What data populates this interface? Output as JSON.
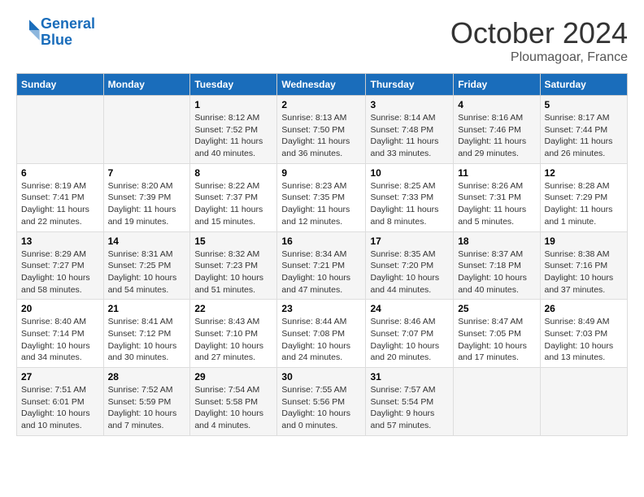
{
  "header": {
    "logo_line1": "General",
    "logo_line2": "Blue",
    "month": "October 2024",
    "location": "Ploumagoar, France"
  },
  "weekdays": [
    "Sunday",
    "Monday",
    "Tuesday",
    "Wednesday",
    "Thursday",
    "Friday",
    "Saturday"
  ],
  "weeks": [
    [
      {
        "num": "",
        "info": ""
      },
      {
        "num": "",
        "info": ""
      },
      {
        "num": "1",
        "info": "Sunrise: 8:12 AM\nSunset: 7:52 PM\nDaylight: 11 hours and 40 minutes."
      },
      {
        "num": "2",
        "info": "Sunrise: 8:13 AM\nSunset: 7:50 PM\nDaylight: 11 hours and 36 minutes."
      },
      {
        "num": "3",
        "info": "Sunrise: 8:14 AM\nSunset: 7:48 PM\nDaylight: 11 hours and 33 minutes."
      },
      {
        "num": "4",
        "info": "Sunrise: 8:16 AM\nSunset: 7:46 PM\nDaylight: 11 hours and 29 minutes."
      },
      {
        "num": "5",
        "info": "Sunrise: 8:17 AM\nSunset: 7:44 PM\nDaylight: 11 hours and 26 minutes."
      }
    ],
    [
      {
        "num": "6",
        "info": "Sunrise: 8:19 AM\nSunset: 7:41 PM\nDaylight: 11 hours and 22 minutes."
      },
      {
        "num": "7",
        "info": "Sunrise: 8:20 AM\nSunset: 7:39 PM\nDaylight: 11 hours and 19 minutes."
      },
      {
        "num": "8",
        "info": "Sunrise: 8:22 AM\nSunset: 7:37 PM\nDaylight: 11 hours and 15 minutes."
      },
      {
        "num": "9",
        "info": "Sunrise: 8:23 AM\nSunset: 7:35 PM\nDaylight: 11 hours and 12 minutes."
      },
      {
        "num": "10",
        "info": "Sunrise: 8:25 AM\nSunset: 7:33 PM\nDaylight: 11 hours and 8 minutes."
      },
      {
        "num": "11",
        "info": "Sunrise: 8:26 AM\nSunset: 7:31 PM\nDaylight: 11 hours and 5 minutes."
      },
      {
        "num": "12",
        "info": "Sunrise: 8:28 AM\nSunset: 7:29 PM\nDaylight: 11 hours and 1 minute."
      }
    ],
    [
      {
        "num": "13",
        "info": "Sunrise: 8:29 AM\nSunset: 7:27 PM\nDaylight: 10 hours and 58 minutes."
      },
      {
        "num": "14",
        "info": "Sunrise: 8:31 AM\nSunset: 7:25 PM\nDaylight: 10 hours and 54 minutes."
      },
      {
        "num": "15",
        "info": "Sunrise: 8:32 AM\nSunset: 7:23 PM\nDaylight: 10 hours and 51 minutes."
      },
      {
        "num": "16",
        "info": "Sunrise: 8:34 AM\nSunset: 7:21 PM\nDaylight: 10 hours and 47 minutes."
      },
      {
        "num": "17",
        "info": "Sunrise: 8:35 AM\nSunset: 7:20 PM\nDaylight: 10 hours and 44 minutes."
      },
      {
        "num": "18",
        "info": "Sunrise: 8:37 AM\nSunset: 7:18 PM\nDaylight: 10 hours and 40 minutes."
      },
      {
        "num": "19",
        "info": "Sunrise: 8:38 AM\nSunset: 7:16 PM\nDaylight: 10 hours and 37 minutes."
      }
    ],
    [
      {
        "num": "20",
        "info": "Sunrise: 8:40 AM\nSunset: 7:14 PM\nDaylight: 10 hours and 34 minutes."
      },
      {
        "num": "21",
        "info": "Sunrise: 8:41 AM\nSunset: 7:12 PM\nDaylight: 10 hours and 30 minutes."
      },
      {
        "num": "22",
        "info": "Sunrise: 8:43 AM\nSunset: 7:10 PM\nDaylight: 10 hours and 27 minutes."
      },
      {
        "num": "23",
        "info": "Sunrise: 8:44 AM\nSunset: 7:08 PM\nDaylight: 10 hours and 24 minutes."
      },
      {
        "num": "24",
        "info": "Sunrise: 8:46 AM\nSunset: 7:07 PM\nDaylight: 10 hours and 20 minutes."
      },
      {
        "num": "25",
        "info": "Sunrise: 8:47 AM\nSunset: 7:05 PM\nDaylight: 10 hours and 17 minutes."
      },
      {
        "num": "26",
        "info": "Sunrise: 8:49 AM\nSunset: 7:03 PM\nDaylight: 10 hours and 13 minutes."
      }
    ],
    [
      {
        "num": "27",
        "info": "Sunrise: 7:51 AM\nSunset: 6:01 PM\nDaylight: 10 hours and 10 minutes."
      },
      {
        "num": "28",
        "info": "Sunrise: 7:52 AM\nSunset: 5:59 PM\nDaylight: 10 hours and 7 minutes."
      },
      {
        "num": "29",
        "info": "Sunrise: 7:54 AM\nSunset: 5:58 PM\nDaylight: 10 hours and 4 minutes."
      },
      {
        "num": "30",
        "info": "Sunrise: 7:55 AM\nSunset: 5:56 PM\nDaylight: 10 hours and 0 minutes."
      },
      {
        "num": "31",
        "info": "Sunrise: 7:57 AM\nSunset: 5:54 PM\nDaylight: 9 hours and 57 minutes."
      },
      {
        "num": "",
        "info": ""
      },
      {
        "num": "",
        "info": ""
      }
    ]
  ]
}
